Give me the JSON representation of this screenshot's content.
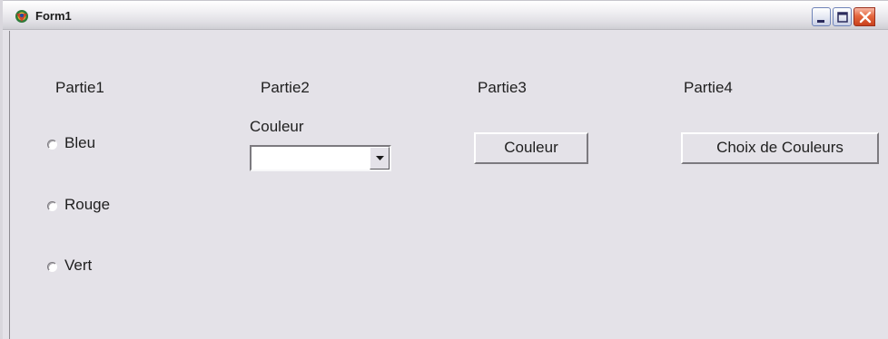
{
  "window": {
    "title": "Form1",
    "icon": "delphi-app-icon",
    "controls": {
      "minimize_icon": "minimize-icon",
      "maximize_icon": "maximize-icon",
      "close_icon": "close-icon"
    }
  },
  "form": {
    "section_labels": [
      "Partie1",
      "Partie2",
      "Partie3",
      "Partie4"
    ],
    "radio_group": {
      "options": [
        "Bleu",
        "Rouge",
        "Vert"
      ],
      "selected": null
    },
    "combo": {
      "label": "Couleur",
      "value": ""
    },
    "buttons": {
      "couleur": "Couleur",
      "choix_couleurs": "Choix de Couleurs"
    }
  },
  "colors": {
    "form_background": "#e4e2e8",
    "close_button": "#e5683f"
  }
}
